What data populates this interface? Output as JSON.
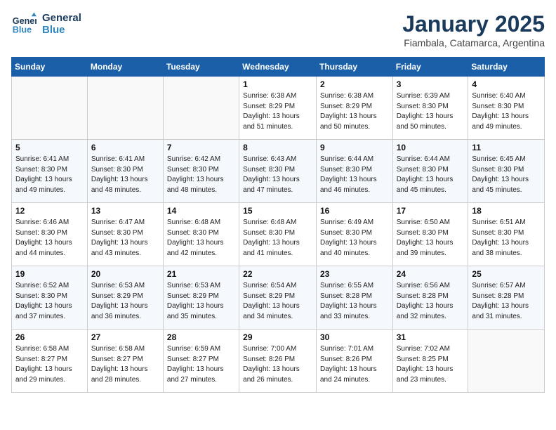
{
  "logo": {
    "line1": "General",
    "line2": "Blue"
  },
  "title": "January 2025",
  "location": "Fiambala, Catamarca, Argentina",
  "days_of_week": [
    "Sunday",
    "Monday",
    "Tuesday",
    "Wednesday",
    "Thursday",
    "Friday",
    "Saturday"
  ],
  "weeks": [
    [
      {
        "day": "",
        "sunrise": "",
        "sunset": "",
        "daylight": ""
      },
      {
        "day": "",
        "sunrise": "",
        "sunset": "",
        "daylight": ""
      },
      {
        "day": "",
        "sunrise": "",
        "sunset": "",
        "daylight": ""
      },
      {
        "day": "1",
        "sunrise": "Sunrise: 6:38 AM",
        "sunset": "Sunset: 8:29 PM",
        "daylight": "Daylight: 13 hours and 51 minutes."
      },
      {
        "day": "2",
        "sunrise": "Sunrise: 6:38 AM",
        "sunset": "Sunset: 8:29 PM",
        "daylight": "Daylight: 13 hours and 50 minutes."
      },
      {
        "day": "3",
        "sunrise": "Sunrise: 6:39 AM",
        "sunset": "Sunset: 8:30 PM",
        "daylight": "Daylight: 13 hours and 50 minutes."
      },
      {
        "day": "4",
        "sunrise": "Sunrise: 6:40 AM",
        "sunset": "Sunset: 8:30 PM",
        "daylight": "Daylight: 13 hours and 49 minutes."
      }
    ],
    [
      {
        "day": "5",
        "sunrise": "Sunrise: 6:41 AM",
        "sunset": "Sunset: 8:30 PM",
        "daylight": "Daylight: 13 hours and 49 minutes."
      },
      {
        "day": "6",
        "sunrise": "Sunrise: 6:41 AM",
        "sunset": "Sunset: 8:30 PM",
        "daylight": "Daylight: 13 hours and 48 minutes."
      },
      {
        "day": "7",
        "sunrise": "Sunrise: 6:42 AM",
        "sunset": "Sunset: 8:30 PM",
        "daylight": "Daylight: 13 hours and 48 minutes."
      },
      {
        "day": "8",
        "sunrise": "Sunrise: 6:43 AM",
        "sunset": "Sunset: 8:30 PM",
        "daylight": "Daylight: 13 hours and 47 minutes."
      },
      {
        "day": "9",
        "sunrise": "Sunrise: 6:44 AM",
        "sunset": "Sunset: 8:30 PM",
        "daylight": "Daylight: 13 hours and 46 minutes."
      },
      {
        "day": "10",
        "sunrise": "Sunrise: 6:44 AM",
        "sunset": "Sunset: 8:30 PM",
        "daylight": "Daylight: 13 hours and 45 minutes."
      },
      {
        "day": "11",
        "sunrise": "Sunrise: 6:45 AM",
        "sunset": "Sunset: 8:30 PM",
        "daylight": "Daylight: 13 hours and 45 minutes."
      }
    ],
    [
      {
        "day": "12",
        "sunrise": "Sunrise: 6:46 AM",
        "sunset": "Sunset: 8:30 PM",
        "daylight": "Daylight: 13 hours and 44 minutes."
      },
      {
        "day": "13",
        "sunrise": "Sunrise: 6:47 AM",
        "sunset": "Sunset: 8:30 PM",
        "daylight": "Daylight: 13 hours and 43 minutes."
      },
      {
        "day": "14",
        "sunrise": "Sunrise: 6:48 AM",
        "sunset": "Sunset: 8:30 PM",
        "daylight": "Daylight: 13 hours and 42 minutes."
      },
      {
        "day": "15",
        "sunrise": "Sunrise: 6:48 AM",
        "sunset": "Sunset: 8:30 PM",
        "daylight": "Daylight: 13 hours and 41 minutes."
      },
      {
        "day": "16",
        "sunrise": "Sunrise: 6:49 AM",
        "sunset": "Sunset: 8:30 PM",
        "daylight": "Daylight: 13 hours and 40 minutes."
      },
      {
        "day": "17",
        "sunrise": "Sunrise: 6:50 AM",
        "sunset": "Sunset: 8:30 PM",
        "daylight": "Daylight: 13 hours and 39 minutes."
      },
      {
        "day": "18",
        "sunrise": "Sunrise: 6:51 AM",
        "sunset": "Sunset: 8:30 PM",
        "daylight": "Daylight: 13 hours and 38 minutes."
      }
    ],
    [
      {
        "day": "19",
        "sunrise": "Sunrise: 6:52 AM",
        "sunset": "Sunset: 8:30 PM",
        "daylight": "Daylight: 13 hours and 37 minutes."
      },
      {
        "day": "20",
        "sunrise": "Sunrise: 6:53 AM",
        "sunset": "Sunset: 8:29 PM",
        "daylight": "Daylight: 13 hours and 36 minutes."
      },
      {
        "day": "21",
        "sunrise": "Sunrise: 6:53 AM",
        "sunset": "Sunset: 8:29 PM",
        "daylight": "Daylight: 13 hours and 35 minutes."
      },
      {
        "day": "22",
        "sunrise": "Sunrise: 6:54 AM",
        "sunset": "Sunset: 8:29 PM",
        "daylight": "Daylight: 13 hours and 34 minutes."
      },
      {
        "day": "23",
        "sunrise": "Sunrise: 6:55 AM",
        "sunset": "Sunset: 8:28 PM",
        "daylight": "Daylight: 13 hours and 33 minutes."
      },
      {
        "day": "24",
        "sunrise": "Sunrise: 6:56 AM",
        "sunset": "Sunset: 8:28 PM",
        "daylight": "Daylight: 13 hours and 32 minutes."
      },
      {
        "day": "25",
        "sunrise": "Sunrise: 6:57 AM",
        "sunset": "Sunset: 8:28 PM",
        "daylight": "Daylight: 13 hours and 31 minutes."
      }
    ],
    [
      {
        "day": "26",
        "sunrise": "Sunrise: 6:58 AM",
        "sunset": "Sunset: 8:27 PM",
        "daylight": "Daylight: 13 hours and 29 minutes."
      },
      {
        "day": "27",
        "sunrise": "Sunrise: 6:58 AM",
        "sunset": "Sunset: 8:27 PM",
        "daylight": "Daylight: 13 hours and 28 minutes."
      },
      {
        "day": "28",
        "sunrise": "Sunrise: 6:59 AM",
        "sunset": "Sunset: 8:27 PM",
        "daylight": "Daylight: 13 hours and 27 minutes."
      },
      {
        "day": "29",
        "sunrise": "Sunrise: 7:00 AM",
        "sunset": "Sunset: 8:26 PM",
        "daylight": "Daylight: 13 hours and 26 minutes."
      },
      {
        "day": "30",
        "sunrise": "Sunrise: 7:01 AM",
        "sunset": "Sunset: 8:26 PM",
        "daylight": "Daylight: 13 hours and 24 minutes."
      },
      {
        "day": "31",
        "sunrise": "Sunrise: 7:02 AM",
        "sunset": "Sunset: 8:25 PM",
        "daylight": "Daylight: 13 hours and 23 minutes."
      },
      {
        "day": "",
        "sunrise": "",
        "sunset": "",
        "daylight": ""
      }
    ]
  ]
}
